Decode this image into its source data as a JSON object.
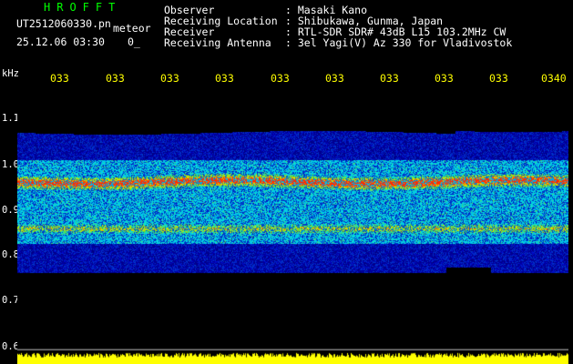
{
  "app": {
    "title": "HROFFT",
    "filename": "UT2512060330.pn",
    "mode": "meteor",
    "timestamp": "25.12.06 03:30",
    "counter": "0_"
  },
  "station": {
    "rows": [
      {
        "key": "Observer",
        "value": ": Masaki Kano"
      },
      {
        "key": "Receiving Location",
        "value": ": Shibukawa, Gunma, Japan"
      },
      {
        "key": "Receiver",
        "value": ": RTL-SDR SDR# 43dB L15 103.2MHz CW"
      },
      {
        "key": "Receiving Antenna",
        "value": ": 3el Yagi(V) Az 330 for Vladivostok"
      }
    ]
  },
  "axes": {
    "unit": "kHz",
    "time_labels": [
      "033",
      "033",
      "033",
      "033",
      "033",
      "033",
      "033",
      "033",
      "033",
      "0340"
    ],
    "freq_labels": [
      "1.1",
      "1.0",
      "0.9",
      "0.8",
      "0.7",
      "0.6"
    ]
  },
  "colors": {
    "background": "#000000",
    "title": "#00ff00",
    "text": "#ffffff",
    "time_label": "#ffff00",
    "signal_floor": "#ffff00",
    "band_low": "#0000b4",
    "band_mid": "#00b4ff",
    "band_high": "#ff3c00"
  },
  "spectrum": {
    "band_lower_khz": 0.77,
    "band_upper_khz": 1.055,
    "core_lower_khz": 0.83,
    "core_upper_khz": 1.0,
    "peak_khz": 0.955,
    "secondary_peak_khz": 0.86,
    "noise_floor_khz": 0.6,
    "scale_top_khz": 1.15,
    "scale_bottom_khz": 0.585
  }
}
